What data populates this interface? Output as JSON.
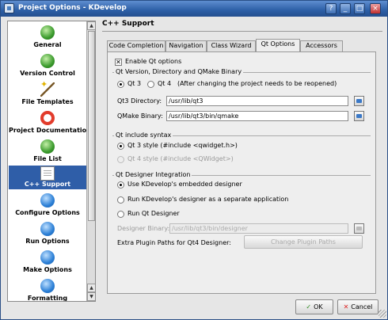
{
  "window": {
    "title": "Project Options - KDevelop"
  },
  "titlebar_buttons": [
    "?",
    "_",
    "□",
    "×"
  ],
  "sidebar": {
    "items": [
      {
        "label": "General",
        "icon": "general-icon"
      },
      {
        "label": "Version Control",
        "icon": "version-control-icon"
      },
      {
        "label": "File Templates",
        "icon": "file-templates-icon"
      },
      {
        "label": "Project Documentation",
        "icon": "project-documentation-icon"
      },
      {
        "label": "File List",
        "icon": "file-list-icon"
      },
      {
        "label": "C++ Support",
        "icon": "cpp-support-icon",
        "selected": true
      },
      {
        "label": "Configure Options",
        "icon": "configure-options-icon"
      },
      {
        "label": "Run Options",
        "icon": "run-options-icon"
      },
      {
        "label": "Make Options",
        "icon": "make-options-icon"
      },
      {
        "label": "Formatting",
        "icon": "formatting-icon"
      }
    ]
  },
  "page": {
    "title": "C++ Support"
  },
  "tabs": [
    {
      "label": "Code Completion"
    },
    {
      "label": "Navigation"
    },
    {
      "label": "Class Wizard"
    },
    {
      "label": "Qt Options",
      "active": true
    },
    {
      "label": "Accessors"
    }
  ],
  "qt": {
    "enable_label": "Enable Qt options",
    "enable_checked": true,
    "version_group": "Qt Version, Directory and QMake Binary",
    "qt3_label": "Qt 3",
    "qt4_label": "Qt 4",
    "version_note": "(After changing the project needs to be reopened)",
    "dir_label": "Qt3 Directory:",
    "dir_value": "/usr/lib/qt3",
    "qmake_label": "QMake Binary:",
    "qmake_value": "/usr/lib/qt3/bin/qmake",
    "include_group": "Qt include syntax",
    "include_qt3": "Qt 3 style (#include <qwidget.h>)",
    "include_qt4": "Qt 4 style (#include <QWidget>)",
    "designer_group": "Qt Designer Integration",
    "designer_opt1": "Use KDevelop's embedded designer",
    "designer_opt2": "Run KDevelop's designer as a separate application",
    "designer_opt3": "Run Qt Designer",
    "designer_binary_label": "Designer Binary:",
    "designer_binary_value": "/usr/lib/qt3/bin/designer",
    "plugin_label": "Extra Plugin Paths for Qt4 Designer:",
    "plugin_button": "Change Plugin Paths"
  },
  "buttons": {
    "ok": "OK",
    "cancel": "Cancel"
  }
}
